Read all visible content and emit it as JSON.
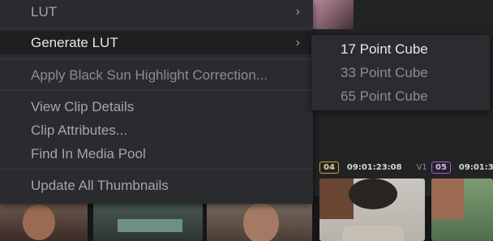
{
  "menu": {
    "items": [
      {
        "label": "LUT",
        "has_submenu": true
      },
      {
        "label": "Generate LUT",
        "has_submenu": true,
        "highlighted": true
      },
      {
        "label": "Apply Black Sun Highlight Correction..."
      },
      {
        "label": "View Clip Details"
      },
      {
        "label": "Clip Attributes..."
      },
      {
        "label": "Find In Media Pool"
      },
      {
        "label": "Update All Thumbnails"
      }
    ],
    "chevron_glyph": "›"
  },
  "submenu": {
    "items": [
      {
        "label": "17 Point Cube"
      },
      {
        "label": "33 Point Cube"
      },
      {
        "label": "65 Point Cube"
      }
    ]
  },
  "clips": [
    {
      "number": "04",
      "timecode": "09:01:23:08",
      "track": "V1",
      "color": "#c9a23a"
    },
    {
      "number": "05",
      "timecode": "09:01:3",
      "color": "#a957d6"
    }
  ]
}
